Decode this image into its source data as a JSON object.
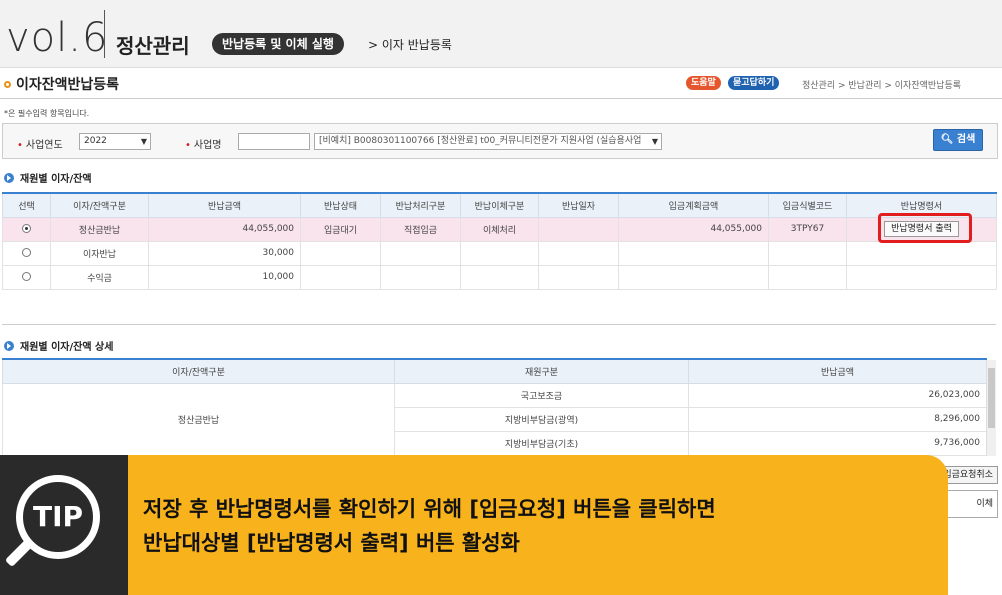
{
  "header": {
    "vol": "vol.6",
    "section": "정산관리",
    "pill": "반납등록 및 이체 실행",
    "crumb": "> 이자 반납등록"
  },
  "page": {
    "title": "이자잔액반납등록",
    "help": "도움말",
    "qa": "묻고답하기",
    "breadcrumbs": "정산관리 > 반납관리 > 이자잔액반납등록",
    "required_note": "*은 필수입력 항목입니다."
  },
  "search": {
    "year_label": "사업연도",
    "year_value": "2022",
    "biz_label": "사업명",
    "biz_value": "[비예치] B0080301100766 [정산완료] t00_커뮤니티전문가 지원사업 (실습용사업",
    "search_button": "검색"
  },
  "section1": {
    "title": "재원별 이자/잔액",
    "columns": [
      "선택",
      "이자/잔액구분",
      "반납금액",
      "반납상태",
      "반납처리구분",
      "반납이체구분",
      "반납일자",
      "입금계획금액",
      "입금식별코드",
      "반납명령서"
    ],
    "rows": [
      {
        "selected": true,
        "type": "정산금반납",
        "amount": "44,055,000",
        "status": "입금대기",
        "proc": "직접입금",
        "transfer": "이체처리",
        "date": "",
        "plan": "44,055,000",
        "code": "3TPY67",
        "print": "반납명령서 출력"
      },
      {
        "selected": false,
        "type": "이자반납",
        "amount": "30,000",
        "status": "",
        "proc": "",
        "transfer": "",
        "date": "",
        "plan": "",
        "code": "",
        "print": ""
      },
      {
        "selected": false,
        "type": "수익금",
        "amount": "10,000",
        "status": "",
        "proc": "",
        "transfer": "",
        "date": "",
        "plan": "",
        "code": "",
        "print": ""
      }
    ]
  },
  "section2": {
    "title": "재원별 이자/잔액 상세",
    "columns": [
      "이자/잔액구분",
      "재원구분",
      "반납금액"
    ],
    "group": "정산금반납",
    "rows": [
      {
        "source": "국고보조금",
        "amount": "26,023,000"
      },
      {
        "source": "지방비부담금(광역)",
        "amount": "8,296,000"
      },
      {
        "source": "지방비부담금(기초)",
        "amount": "9,736,000"
      }
    ]
  },
  "actions": {
    "cancel": "입금요청취소",
    "execute": "이체"
  },
  "tip": {
    "badge": "TIP",
    "line1": "저장 후 반납명령서를 확인하기 위해 [입금요청] 버튼을 클릭하면",
    "line2": "반납대상별 [반납명령서 출력] 버튼 활성화"
  },
  "colors": {
    "accent": "#3a80d0",
    "highlight_row": "#f9e3ec",
    "tip_yellow": "#f7b21c",
    "red_box": "#e21d1d"
  }
}
